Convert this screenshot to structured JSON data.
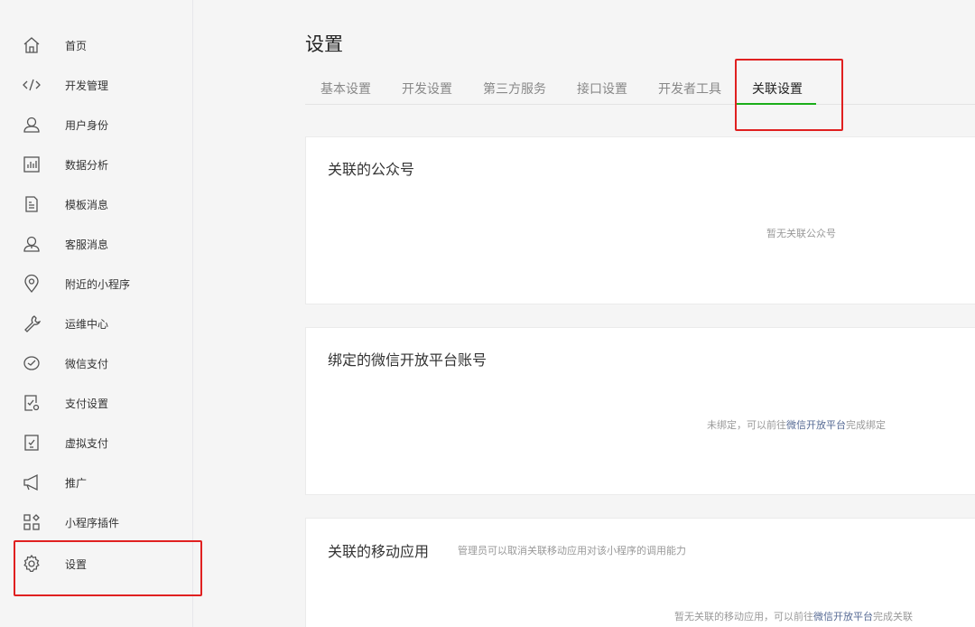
{
  "sidebar": {
    "items": [
      {
        "label": "首页"
      },
      {
        "label": "开发管理"
      },
      {
        "label": "用户身份"
      },
      {
        "label": "数据分析"
      },
      {
        "label": "模板消息"
      },
      {
        "label": "客服消息"
      },
      {
        "label": "附近的小程序"
      },
      {
        "label": "运维中心"
      },
      {
        "label": "微信支付"
      },
      {
        "label": "支付设置"
      },
      {
        "label": "虚拟支付"
      },
      {
        "label": "推广"
      },
      {
        "label": "小程序插件"
      },
      {
        "label": "设置"
      }
    ]
  },
  "page": {
    "title": "设置"
  },
  "tabs": [
    {
      "label": "基本设置"
    },
    {
      "label": "开发设置"
    },
    {
      "label": "第三方服务"
    },
    {
      "label": "接口设置"
    },
    {
      "label": "开发者工具"
    },
    {
      "label": "关联设置"
    }
  ],
  "cards": {
    "official": {
      "title": "关联的公众号",
      "empty": "暂无关联公众号"
    },
    "open_platform": {
      "title": "绑定的微信开放平台账号",
      "empty_prefix": "未绑定，可以前往",
      "empty_link": "微信开放平台",
      "empty_suffix": "完成绑定"
    },
    "mobile_app": {
      "title": "关联的移动应用",
      "subtitle": "管理员可以取消关联移动应用对该小程序的调用能力",
      "empty_prefix": "暂无关联的移动应用，可以前往",
      "empty_link": "微信开放平台",
      "empty_suffix": "完成关联"
    }
  },
  "colors": {
    "highlight": "#e02020",
    "active_tab": "#1aad19",
    "link": "#576b95"
  }
}
